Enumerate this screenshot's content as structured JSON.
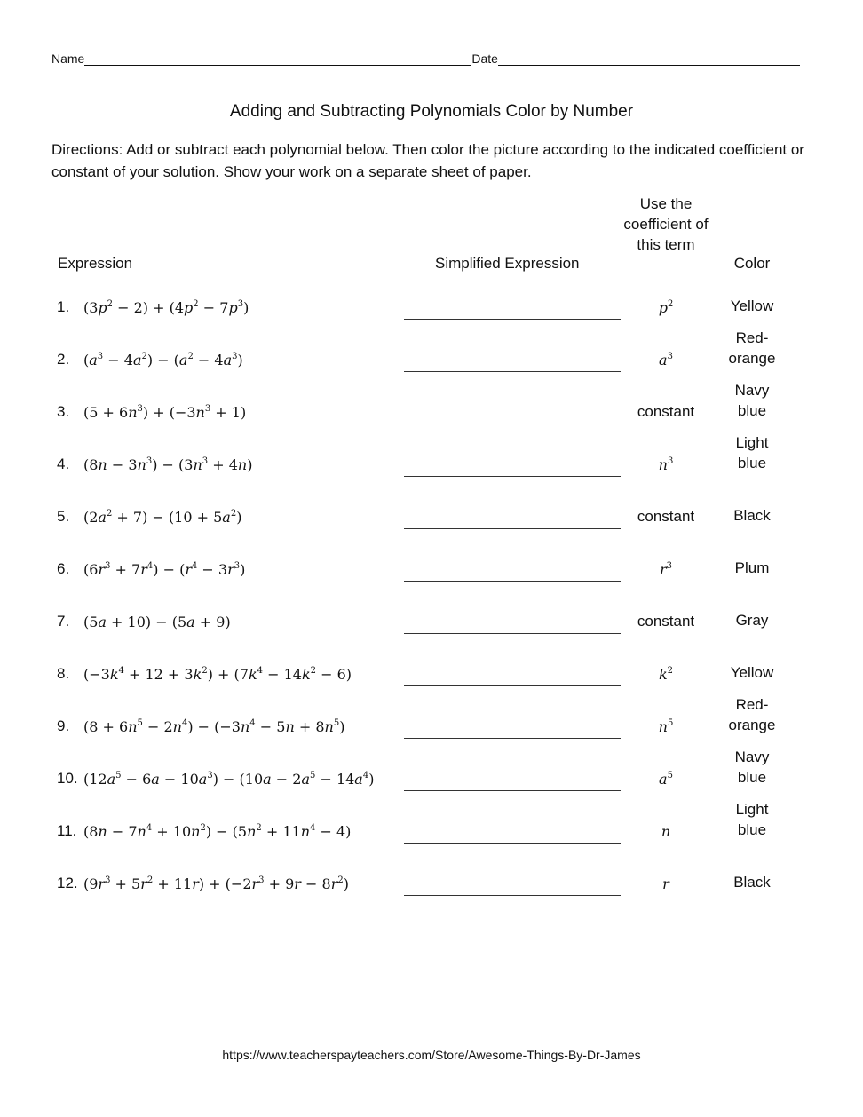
{
  "header": {
    "name_label": "Name",
    "date_label": "Date"
  },
  "title": "Adding and Subtracting Polynomials Color by Number",
  "directions": "Directions: Add or subtract each polynomial below.  Then color the picture according to the indicated coefficient or constant of your solution. Show your work on a separate sheet of paper.",
  "columns": {
    "expression": "Expression",
    "simplified": "Simplified Expression",
    "coefficient": "Use the coefficient of this term",
    "color": "Color"
  },
  "rows": [
    {
      "num": "1.",
      "expr": [
        [
          "(3",
          ""
        ],
        [
          "p",
          "2"
        ],
        [
          " − 2) + (4",
          ""
        ],
        [
          "p",
          "2"
        ],
        [
          " − 7",
          ""
        ],
        [
          "p",
          "3"
        ],
        [
          ")",
          ""
        ]
      ],
      "term": [
        [
          "p",
          "2"
        ]
      ],
      "term_text": "",
      "color": "Yellow"
    },
    {
      "num": "2.",
      "expr": [
        [
          "(",
          ""
        ],
        [
          "a",
          "3"
        ],
        [
          " − 4",
          ""
        ],
        [
          "a",
          "2"
        ],
        [
          ") − (",
          ""
        ],
        [
          "a",
          "2"
        ],
        [
          " − 4",
          ""
        ],
        [
          "a",
          "3"
        ],
        [
          ")",
          ""
        ]
      ],
      "term": [
        [
          "a",
          "3"
        ]
      ],
      "term_text": "",
      "color": "Red-orange"
    },
    {
      "num": "3.",
      "expr": [
        [
          "(5 + 6",
          ""
        ],
        [
          "n",
          "3"
        ],
        [
          ") + (−3",
          ""
        ],
        [
          "n",
          "3"
        ],
        [
          " + 1)",
          ""
        ]
      ],
      "term": [],
      "term_text": "constant",
      "color": "Navy blue"
    },
    {
      "num": "4.",
      "expr": [
        [
          "(8",
          ""
        ],
        [
          "n",
          ""
        ],
        [
          " − 3",
          ""
        ],
        [
          "n",
          "3"
        ],
        [
          ") − (3",
          ""
        ],
        [
          "n",
          "3"
        ],
        [
          " + 4",
          ""
        ],
        [
          "n",
          ""
        ],
        [
          ")",
          ""
        ]
      ],
      "term": [
        [
          "n",
          "3"
        ]
      ],
      "term_text": "",
      "color": "Light blue"
    },
    {
      "num": "5.",
      "expr": [
        [
          "(2",
          ""
        ],
        [
          "a",
          "2"
        ],
        [
          " + 7) − (10 + 5",
          ""
        ],
        [
          "a",
          "2"
        ],
        [
          ")",
          ""
        ]
      ],
      "term": [],
      "term_text": "constant",
      "color": "Black"
    },
    {
      "num": "6.",
      "expr": [
        [
          "(6",
          ""
        ],
        [
          "r",
          "3"
        ],
        [
          " + 7",
          ""
        ],
        [
          "r",
          "4"
        ],
        [
          ") − (",
          ""
        ],
        [
          "r",
          "4"
        ],
        [
          " − 3",
          ""
        ],
        [
          "r",
          "3"
        ],
        [
          ")",
          ""
        ]
      ],
      "term": [
        [
          "r",
          "3"
        ]
      ],
      "term_text": "",
      "color": "Plum"
    },
    {
      "num": "7.",
      "expr": [
        [
          "(5",
          ""
        ],
        [
          "a",
          ""
        ],
        [
          " + 10) − (5",
          ""
        ],
        [
          "a",
          ""
        ],
        [
          " + 9)",
          ""
        ]
      ],
      "term": [],
      "term_text": "constant",
      "color": "Gray"
    },
    {
      "num": "8.",
      "expr": [
        [
          "(−3",
          ""
        ],
        [
          "k",
          "4"
        ],
        [
          " + 12 + 3",
          ""
        ],
        [
          "k",
          "2"
        ],
        [
          ") + (7",
          ""
        ],
        [
          "k",
          "4"
        ],
        [
          " − 14",
          ""
        ],
        [
          "k",
          "2"
        ],
        [
          " − 6)",
          ""
        ]
      ],
      "term": [
        [
          "k",
          "2"
        ]
      ],
      "term_text": "",
      "color": "Yellow"
    },
    {
      "num": "9.",
      "expr": [
        [
          "(8 + 6",
          ""
        ],
        [
          "n",
          "5"
        ],
        [
          " − 2",
          ""
        ],
        [
          "n",
          "4"
        ],
        [
          ") − (−3",
          ""
        ],
        [
          "n",
          "4"
        ],
        [
          " − 5",
          ""
        ],
        [
          "n",
          ""
        ],
        [
          " + 8",
          ""
        ],
        [
          "n",
          "5"
        ],
        [
          ")",
          ""
        ]
      ],
      "term": [
        [
          "n",
          "5"
        ]
      ],
      "term_text": "",
      "color": "Red-orange"
    },
    {
      "num": "10.",
      "expr": [
        [
          "(12",
          ""
        ],
        [
          "a",
          "5"
        ],
        [
          " − 6",
          ""
        ],
        [
          "a",
          ""
        ],
        [
          " − 10",
          ""
        ],
        [
          "a",
          "3"
        ],
        [
          ") − (10",
          ""
        ],
        [
          "a",
          ""
        ],
        [
          " − 2",
          ""
        ],
        [
          "a",
          "5"
        ],
        [
          " − 14",
          ""
        ],
        [
          "a",
          "4"
        ],
        [
          ")",
          ""
        ]
      ],
      "term": [
        [
          "a",
          "5"
        ]
      ],
      "term_text": "",
      "color": "Navy blue"
    },
    {
      "num": "11.",
      "expr": [
        [
          "(8",
          ""
        ],
        [
          "n",
          ""
        ],
        [
          " − 7",
          ""
        ],
        [
          "n",
          "4"
        ],
        [
          " + 10",
          ""
        ],
        [
          "n",
          "2"
        ],
        [
          ") − (5",
          ""
        ],
        [
          "n",
          "2"
        ],
        [
          " + 11",
          ""
        ],
        [
          "n",
          "4"
        ],
        [
          " − 4)",
          ""
        ]
      ],
      "term": [
        [
          "n",
          ""
        ]
      ],
      "term_text": "",
      "color": "Light blue"
    },
    {
      "num": "12.",
      "expr": [
        [
          "(9",
          ""
        ],
        [
          "r",
          "3"
        ],
        [
          " + 5",
          ""
        ],
        [
          "r",
          "2"
        ],
        [
          " + 11",
          ""
        ],
        [
          "r",
          ""
        ],
        [
          ") + (−2",
          ""
        ],
        [
          "r",
          "3"
        ],
        [
          " + 9",
          ""
        ],
        [
          "r",
          ""
        ],
        [
          " − 8",
          ""
        ],
        [
          "r",
          "2"
        ],
        [
          ")",
          ""
        ]
      ],
      "term": [
        [
          "r",
          ""
        ]
      ],
      "term_text": "",
      "color": "Black"
    }
  ],
  "footer": "https://www.teacherspayteachers.com/Store/Awesome-Things-By-Dr-James"
}
